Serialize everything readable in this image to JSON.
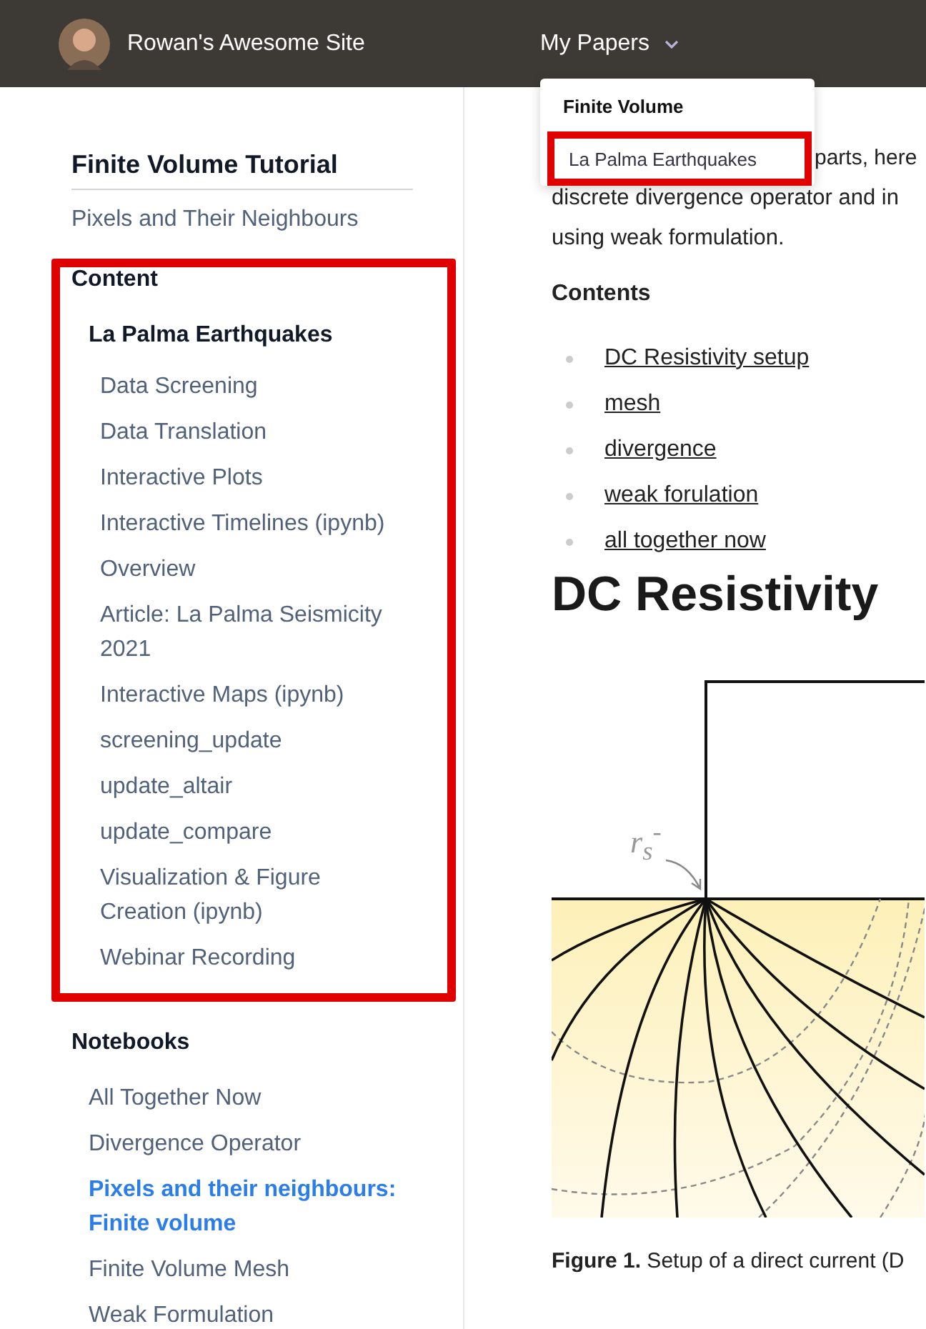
{
  "header": {
    "site_title": "Rowan's Awesome Site",
    "nav": [
      {
        "label": "My Papers",
        "expanded": true
      }
    ]
  },
  "dropdown": {
    "heading": "Finite Volume",
    "items": [
      {
        "label": "La Palma Earthquakes",
        "highlighted": true
      }
    ]
  },
  "sidebar": {
    "title": "Finite Volume Tutorial",
    "link": "Pixels and Their Neighbours",
    "sections": [
      {
        "heading": "Content",
        "highlighted": true,
        "items": [
          {
            "label": "La Palma Earthquakes",
            "selected": false,
            "children": [
              {
                "label": "Data Screening",
                "selected": false
              },
              {
                "label": "Data Translation",
                "selected": false
              },
              {
                "label": "Interactive Plots",
                "selected": false
              },
              {
                "label": "Interactive Timelines (ipynb)",
                "selected": false
              },
              {
                "label": "Overview",
                "selected": false
              },
              {
                "label": "Article: La Palma Seismicity 2021",
                "selected": false
              },
              {
                "label": "Interactive Maps (ipynb)",
                "selected": false
              },
              {
                "label": "screening_update",
                "selected": false
              },
              {
                "label": "update_altair",
                "selected": false
              },
              {
                "label": "update_compare",
                "selected": false
              },
              {
                "label": "Visualization & Figure Creation (ipynb)",
                "selected": false
              },
              {
                "label": "Webinar Recording",
                "selected": false
              }
            ]
          }
        ]
      },
      {
        "heading": "Notebooks",
        "highlighted": false,
        "items": [
          {
            "label": "All Together Now",
            "selected": false
          },
          {
            "label": "Divergence Operator",
            "selected": false
          },
          {
            "label": "Pixels and their neighbours: Finite volume",
            "selected": true
          },
          {
            "label": "Finite Volume Mesh",
            "selected": false
          },
          {
            "label": "Weak Formulation",
            "selected": false
          }
        ]
      }
    ]
  },
  "article": {
    "intro_lines": [
      "parts, here",
      "discrete divergence operator and in",
      "using weak formulation."
    ],
    "contents_heading": "Contents",
    "contents": [
      "DC Resistivity setup",
      "mesh",
      "divergence",
      "weak forulation",
      "all together now"
    ],
    "heading": "DC Resistivity",
    "figure_label": "r$_{s}$$^{-}$",
    "caption": "**Figure 1.** Setup of a direct current (D"
  }
}
